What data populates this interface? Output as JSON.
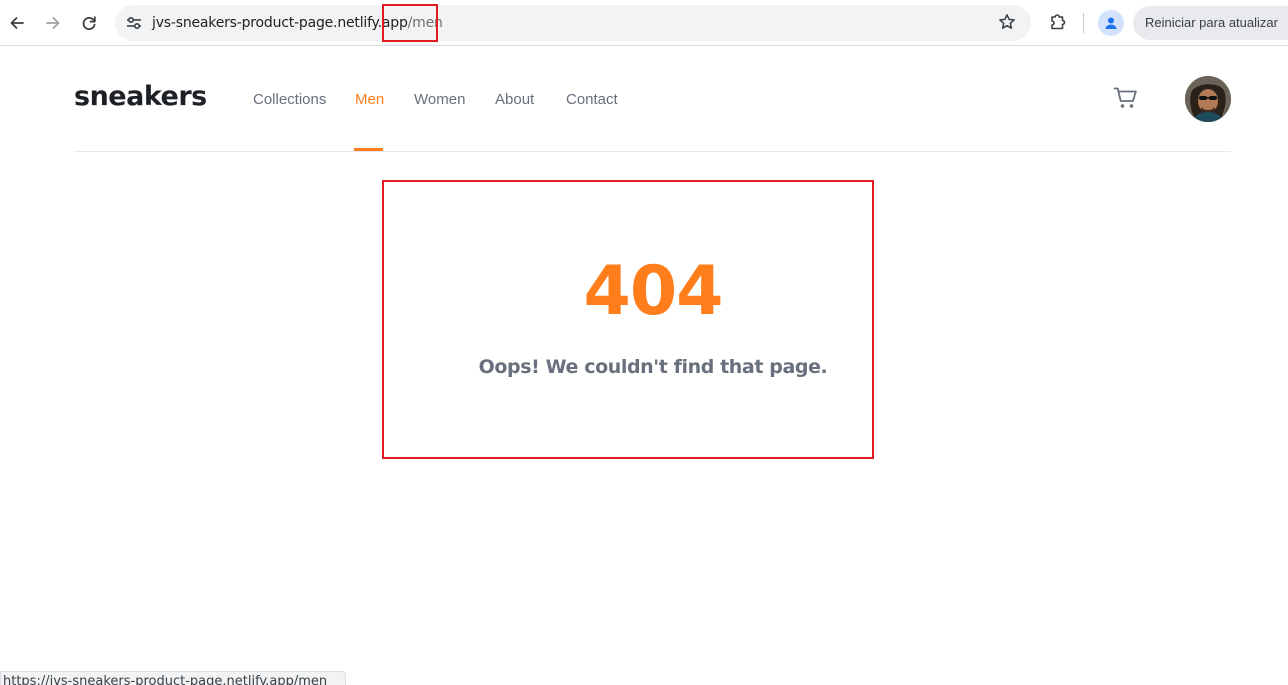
{
  "browser": {
    "url_host": "jvs-sneakers-product-page.netlify.app",
    "url_path": "/men",
    "update_button_label": "Reiniciar para atualizar",
    "icons": {
      "back": "arrow-left-icon",
      "forward": "arrow-right-icon",
      "reload": "reload-icon",
      "site_info": "tune-icon",
      "bookmark": "star-icon",
      "extensions": "puzzle-icon",
      "profile": "person-icon"
    }
  },
  "site": {
    "logo": "sneakers",
    "nav": [
      {
        "label": "Collections",
        "active": false
      },
      {
        "label": "Men",
        "active": true
      },
      {
        "label": "Women",
        "active": false
      },
      {
        "label": "About",
        "active": false
      },
      {
        "label": "Contact",
        "active": false
      }
    ],
    "accent_color": "#ff7e1b",
    "icons": {
      "cart": "cart-icon",
      "avatar": "user-avatar"
    }
  },
  "error": {
    "code": "404",
    "message": "Oops! We couldn't find that page."
  },
  "status_bar": {
    "text": "https://jvs-sneakers-product-page.netlify.app/men"
  }
}
